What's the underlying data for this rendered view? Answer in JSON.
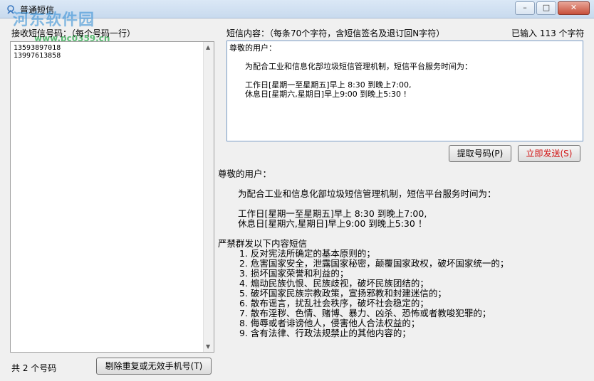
{
  "window": {
    "title": "普通短信",
    "watermark": "河东软件园",
    "watermark_url": "www.pc0359.cn",
    "controls": {
      "minimize": "–",
      "maximize": "□",
      "close": "✕"
    }
  },
  "left_panel": {
    "label": "接收短信号码：（每个号码一行）",
    "numbers": [
      "13593897018",
      "13997613858"
    ],
    "count_text": "共 2 个号码",
    "dedupe_button": "剔除重复或无效手机号(T)"
  },
  "right_panel": {
    "label": "短信内容：（每条70个字符，含短信签名及退订回N字符）",
    "typed_count": "已输入 113 个字符",
    "content_lines": [
      "尊敬的用户：",
      "",
      "为配合工业和信息化部垃圾短信管理机制，短信平台服务时间为：",
      "",
      "工作日[星期一至星期五]早上 8:30 到晚上7:00,",
      "休息日[星期六,星期日]早上9:00 到晚上5:30 !"
    ],
    "extract_button": "提取号码(P)",
    "send_button": "立即发送(S)"
  },
  "preview": {
    "greeting": "尊敬的用户：",
    "intro": "为配合工业和信息化部垃圾短信管理机制，短信平台服务时间为：",
    "hours": [
      "工作日[星期一至星期五]早上 8:30 到晚上7:00,",
      "休息日[星期六,星期日]早上9:00 到晚上5:30 ！"
    ],
    "ban_title": "严禁群发以下内容短信",
    "ban_items": [
      "1. 反对宪法所确定的基本原则的；",
      "2. 危害国家安全，泄露国家秘密，颠覆国家政权，破坏国家统一的；",
      "3. 损坏国家荣誉和利益的；",
      "4. 煽动民族仇恨、民族歧视，破坏民族团结的；",
      "5. 破坏国家民族宗教政策，宣扬邪教和封建迷信的；",
      "6. 散布谣言，扰乱社会秩序，破坏社会稳定的；",
      "7. 散布淫秽、色情、赌博、暴力、凶杀、恐怖或者教唆犯罪的；",
      "8. 侮辱或者诽谤他人，侵害他人合法权益的；",
      "9. 含有法律、行政法规禁止的其他内容的；"
    ]
  }
}
